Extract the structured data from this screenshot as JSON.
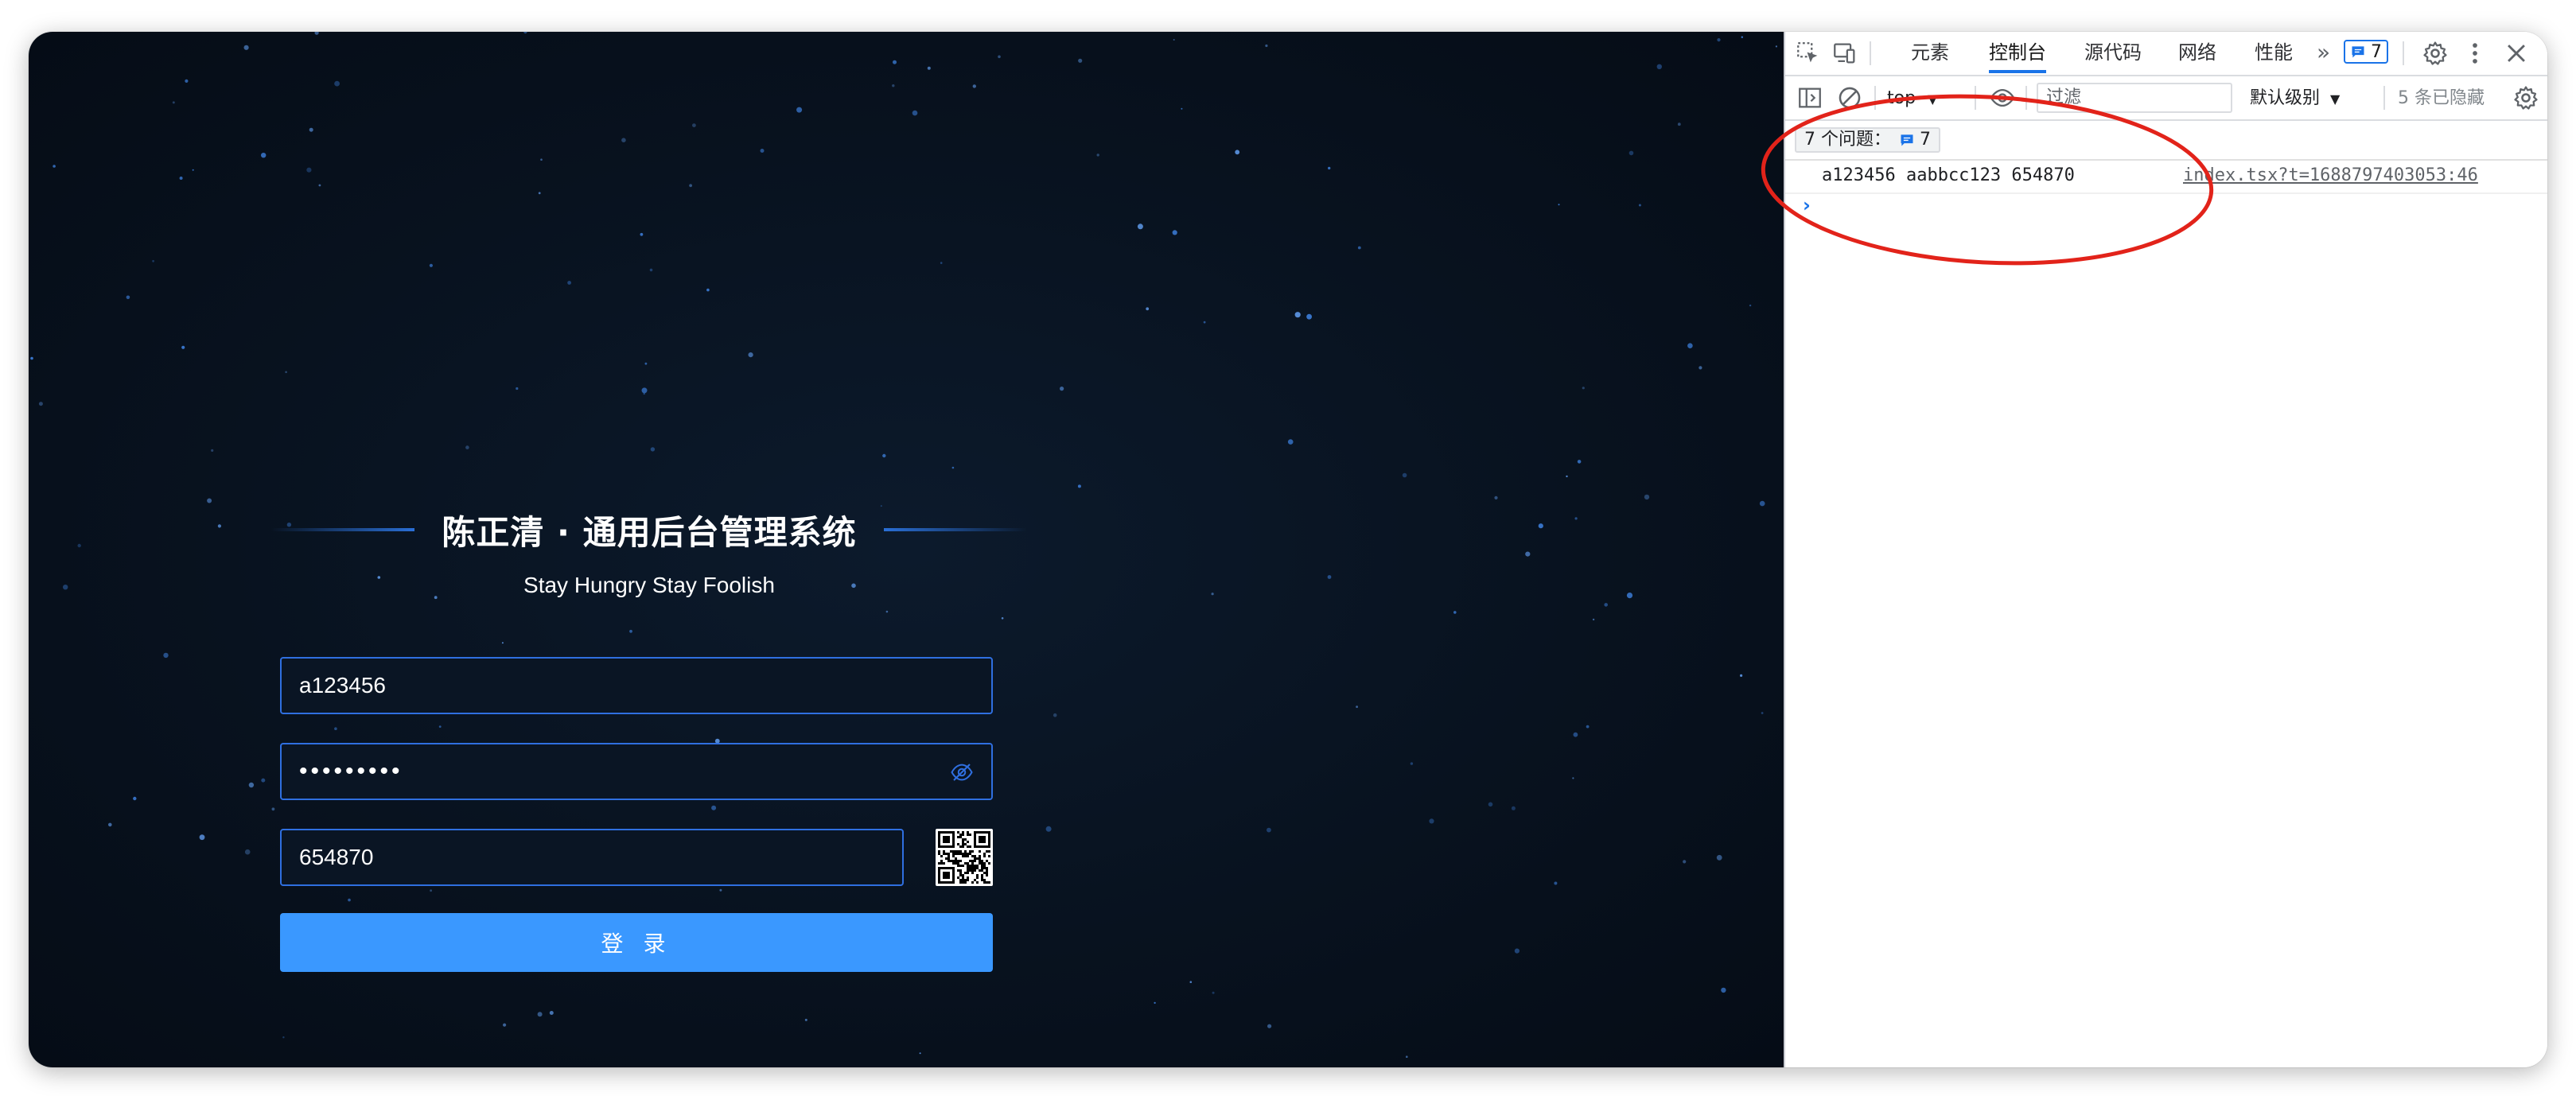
{
  "login": {
    "title": "陈正清 · 通用后台管理系统",
    "subtitle": "Stay Hungry Stay Foolish",
    "username_value": "a123456",
    "password_value": "aabbcc123",
    "code_value": "654870",
    "login_button": "登 录",
    "eye_icon": "eye-off-icon",
    "captcha_icon": "qr-code-icon"
  },
  "devtools": {
    "tabs": [
      {
        "label": "元素"
      },
      {
        "label": "控制台"
      },
      {
        "label": "源代码"
      },
      {
        "label": "网络"
      },
      {
        "label": "性能"
      }
    ],
    "active_tab": "控制台",
    "more_tabs": "»",
    "issue_badge_count": "7",
    "context": "top",
    "filter_placeholder": "过滤",
    "level": "默认级别",
    "hidden_count": "5 条已隐藏",
    "issues_label": "7 个问题：",
    "issues_count": "7",
    "log": {
      "text": "a123456 aabbcc123 654870",
      "source": "index.tsx?t=1688797403053:46"
    },
    "prompt": "›",
    "accent_color": "#1a73e8"
  },
  "annotation": {
    "color": "#e2231a",
    "shape": "ellipse"
  }
}
